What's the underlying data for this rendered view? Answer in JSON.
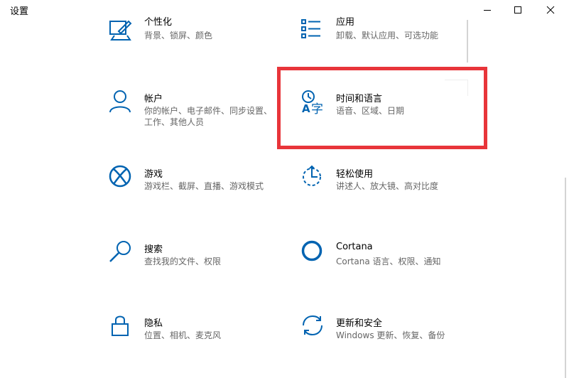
{
  "window": {
    "title": "设置",
    "controls": {
      "minimize": "minimize-icon",
      "maximize": "maximize-icon",
      "close": "close-icon"
    }
  },
  "accent_color": "#0063b1",
  "highlight_color": "#e8353a",
  "tiles": [
    {
      "id": "personalization",
      "name": "个性化",
      "desc": "背景、锁屏、颜色",
      "icon": "personalization-icon"
    },
    {
      "id": "apps",
      "name": "应用",
      "desc": "卸载、默认应用、可选功能",
      "icon": "apps-icon"
    },
    {
      "id": "accounts",
      "name": "帐户",
      "desc": "你的帐户、电子邮件、同步设置、工作、其他人员",
      "icon": "person-icon"
    },
    {
      "id": "time-language",
      "name": "时间和语言",
      "desc": "语音、区域、日期",
      "icon": "time-language-icon"
    },
    {
      "id": "gaming",
      "name": "游戏",
      "desc": "游戏栏、截屏、直播、游戏模式",
      "icon": "xbox-icon"
    },
    {
      "id": "ease-of-access",
      "name": "轻松使用",
      "desc": "讲述人、放大镜、高对比度",
      "icon": "ease-of-access-icon"
    },
    {
      "id": "search",
      "name": "搜索",
      "desc": "查找我的文件、权限",
      "icon": "search-icon"
    },
    {
      "id": "cortana",
      "name": "Cortana",
      "desc": "Cortana 语言、权限、通知",
      "icon": "cortana-icon"
    },
    {
      "id": "privacy",
      "name": "隐私",
      "desc": "位置、相机、麦克风",
      "icon": "lock-icon"
    },
    {
      "id": "update-security",
      "name": "更新和安全",
      "desc": "Windows 更新、恢复、备份",
      "icon": "sync-icon"
    }
  ]
}
